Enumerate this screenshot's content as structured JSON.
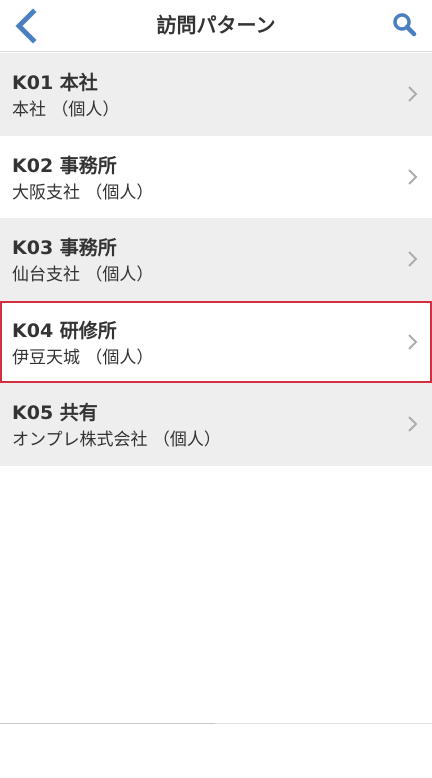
{
  "header": {
    "title": "訪問パターン",
    "back_icon": "chevron-left-icon",
    "search_icon": "search-icon",
    "accent_color": "#4a7fc1"
  },
  "items": [
    {
      "code_title": "K01 本社",
      "subtitle": "本社 （個人）"
    },
    {
      "code_title": "K02 事務所",
      "subtitle": "大阪支社 （個人）"
    },
    {
      "code_title": "K03 事務所",
      "subtitle": "仙台支社 （個人）"
    },
    {
      "code_title": "K04 研修所",
      "subtitle": "伊豆天城 （個人）"
    },
    {
      "code_title": "K05 共有",
      "subtitle": "オンプレ株式会社 （個人）"
    }
  ],
  "selected_index": 3,
  "colors": {
    "row_shaded": "#eeeeee",
    "row_plain": "#ffffff",
    "selection_border": "#d32f3f"
  }
}
